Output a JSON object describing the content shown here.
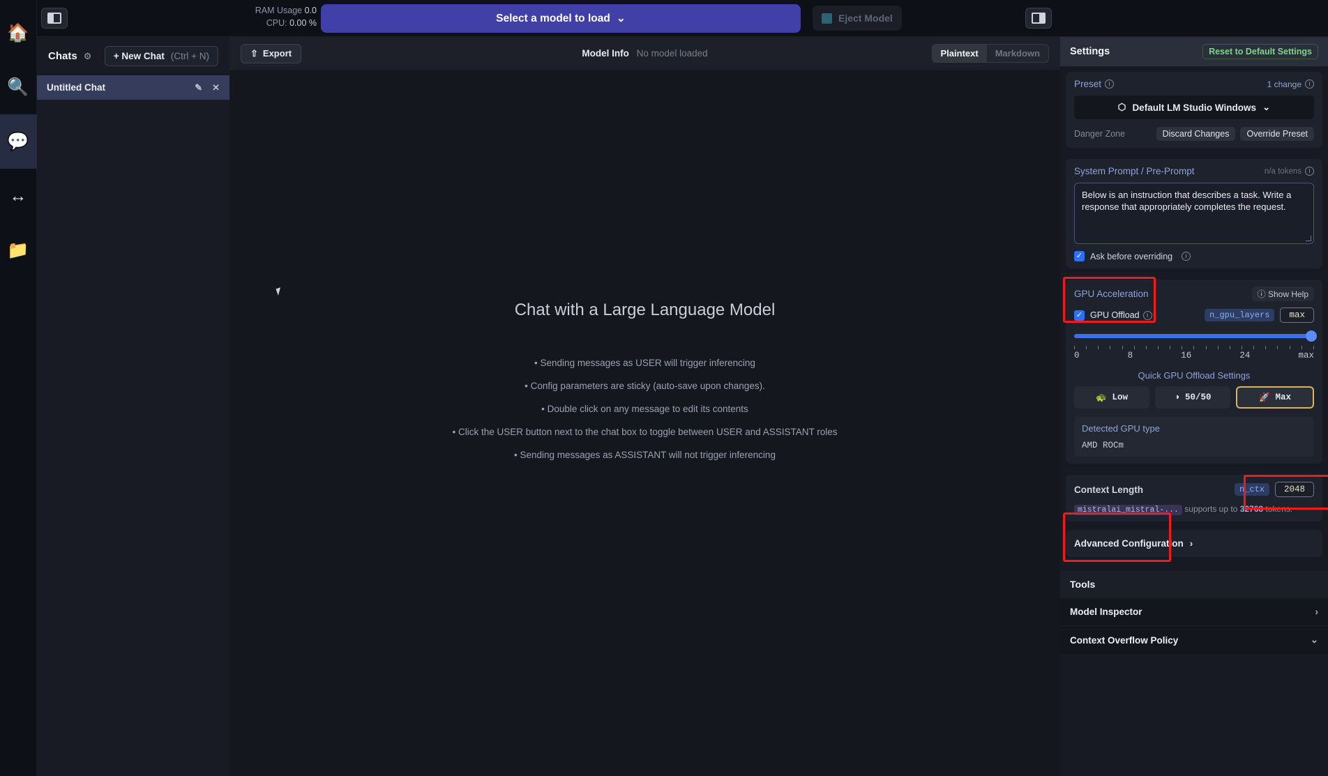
{
  "rail": {
    "items": [
      {
        "name": "home",
        "glyph": "🏠",
        "active": false
      },
      {
        "name": "search",
        "glyph": "🔍",
        "active": false
      },
      {
        "name": "chat",
        "glyph": "💬",
        "active": true
      },
      {
        "name": "resize",
        "glyph": "↔",
        "active": false
      },
      {
        "name": "folder",
        "glyph": "📁",
        "active": false
      }
    ]
  },
  "sidebar": {
    "chats_title": "Chats",
    "gear_icon": "gear-icon",
    "new_chat_label": "+ New Chat",
    "new_chat_shortcut": "(Ctrl + N)",
    "chat_items": [
      {
        "title": "Untitled Chat",
        "edit_icon": "✎",
        "close_icon": "✕"
      }
    ]
  },
  "topbar": {
    "ram_label": "RAM Usage",
    "ram_value": "0.0",
    "cpu_label": "CPU:",
    "cpu_value": "0.00 %",
    "load_button": "Select a model to load",
    "load_chevron": "⌄",
    "eject_button": "Eject Model"
  },
  "subbar": {
    "export_label": "Export",
    "export_icon": "⇧",
    "model_info_label": "Model Info",
    "model_info_value": "No model loaded",
    "view_modes": [
      "Plaintext",
      "Markdown"
    ],
    "view_mode_selected": "Plaintext"
  },
  "main": {
    "hero_title": "Chat with a Large Language Model",
    "bullets": [
      "Sending messages as USER will trigger inferencing",
      "Config parameters are sticky (auto-save upon changes).",
      "Double click on any message to edit its contents",
      "Click the USER button next to the chat box to toggle between USER and ASSISTANT roles",
      "Sending messages as ASSISTANT will not trigger inferencing"
    ]
  },
  "settings": {
    "title": "Settings",
    "reset_label": "Reset to Default Settings",
    "preset": {
      "label": "Preset",
      "changes": "1 change",
      "selected": "Default LM Studio Windows",
      "cube_icon": "⬡",
      "chevron": "⌄",
      "danger_zone_label": "Danger Zone",
      "discard_label": "Discard Changes",
      "override_label": "Override Preset"
    },
    "system_prompt": {
      "label": "System Prompt / Pre-Prompt",
      "tokens": "n/a tokens",
      "value": "Below is an instruction that describes a task. Write a response that appropriately completes the request.",
      "ask_before_overriding": "Ask before overriding",
      "ask_checked": true
    },
    "gpu": {
      "label": "GPU Acceleration",
      "show_help": "Show Help",
      "offload_label": "GPU Offload",
      "offload_checked": true,
      "param_name": "n_gpu_layers",
      "param_value": "max",
      "slider_ticks": [
        "0",
        "8",
        "16",
        "24",
        "max"
      ],
      "slider_position_pct": 100,
      "quick_label": "Quick GPU Offload Settings",
      "quick_buttons": [
        {
          "label": "Low",
          "icon": "🐢",
          "selected": false
        },
        {
          "label": "50/50",
          "icon": "◑",
          "selected": false
        },
        {
          "label": "Max",
          "icon": "🚀",
          "selected": true
        }
      ],
      "detected_label": "Detected GPU type",
      "detected_value": "AMD  ROCm"
    },
    "context": {
      "label": "Context Length",
      "param_name": "n_ctx",
      "param_value": "2048",
      "model_name": "mistralai_mistral-...",
      "supports_prefix": "supports up to",
      "supports_tokens": "32768",
      "supports_suffix": "tokens."
    },
    "advanced_label": "Advanced Configuration",
    "advanced_chevron": "›",
    "tools_label": "Tools",
    "tool_rows": [
      {
        "label": "Model Inspector",
        "chevron": "›"
      },
      {
        "label": "Context Overflow Policy",
        "chevron": "⌄"
      }
    ],
    "highlight_color": "#f21b1b"
  }
}
